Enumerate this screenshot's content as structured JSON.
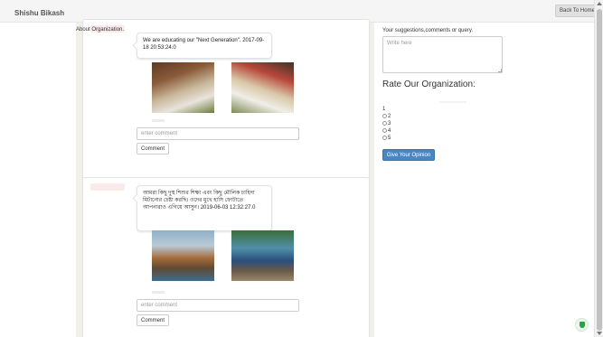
{
  "navbar": {
    "brand": "Shishu Bikash",
    "back_button": "Back To Home",
    "back_caret": "▾"
  },
  "about": "About Organization.",
  "posts": [
    {
      "text": "We are educating our \"Next Generation\". 2017-09-18 20:53:24.0",
      "comment_placeholder": "enter comment",
      "comment_button": "Comment"
    },
    {
      "text": "আমরা কিছু দুস্থ শিশুর শিক্ষা এবং কিছু মৌলিক চাহিদা মিটানোর চেষ্টা করছি। ওদের মুখে হাসি ফোটাতে আপনারাও এগিয়ে আসুন। 2019-06-03 12:32:27.0",
      "comment_placeholder": "enter comment",
      "comment_button": "Comment"
    }
  ],
  "feedback": {
    "label": "Your suggestions,comments or query.",
    "placeholder": "Write here",
    "rate_title": "Rate Our Organization:",
    "options": [
      "1",
      "2",
      "3",
      "4",
      "5"
    ],
    "submit_button": "Give Your Opinion"
  }
}
